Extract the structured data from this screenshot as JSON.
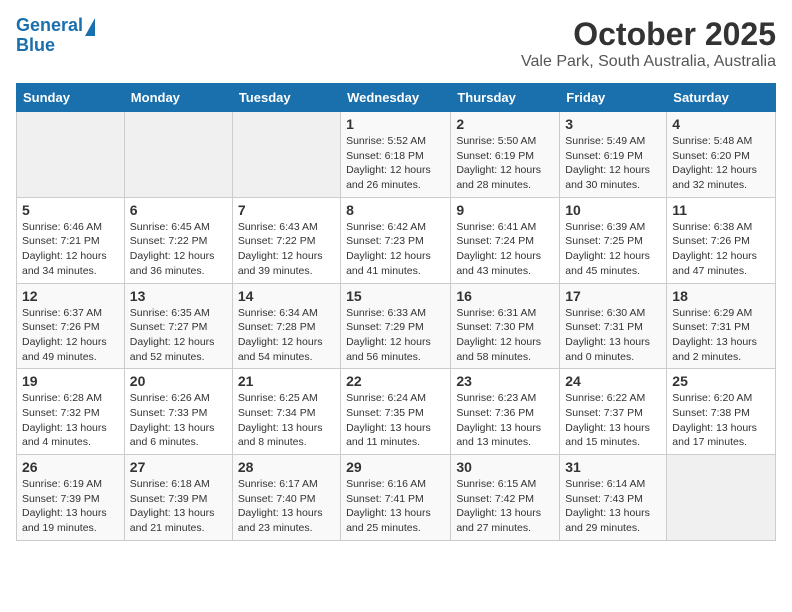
{
  "header": {
    "logo_line1": "General",
    "logo_line2": "Blue",
    "title": "October 2025",
    "subtitle": "Vale Park, South Australia, Australia"
  },
  "days_of_week": [
    "Sunday",
    "Monday",
    "Tuesday",
    "Wednesday",
    "Thursday",
    "Friday",
    "Saturday"
  ],
  "weeks": [
    [
      {
        "day": "",
        "empty": true
      },
      {
        "day": "",
        "empty": true
      },
      {
        "day": "",
        "empty": true
      },
      {
        "day": "1",
        "sunrise": "5:52 AM",
        "sunset": "6:18 PM",
        "daylight": "12 hours and 26 minutes."
      },
      {
        "day": "2",
        "sunrise": "5:50 AM",
        "sunset": "6:19 PM",
        "daylight": "12 hours and 28 minutes."
      },
      {
        "day": "3",
        "sunrise": "5:49 AM",
        "sunset": "6:19 PM",
        "daylight": "12 hours and 30 minutes."
      },
      {
        "day": "4",
        "sunrise": "5:48 AM",
        "sunset": "6:20 PM",
        "daylight": "12 hours and 32 minutes."
      }
    ],
    [
      {
        "day": "5",
        "sunrise": "6:46 AM",
        "sunset": "7:21 PM",
        "daylight": "12 hours and 34 minutes."
      },
      {
        "day": "6",
        "sunrise": "6:45 AM",
        "sunset": "7:22 PM",
        "daylight": "12 hours and 36 minutes."
      },
      {
        "day": "7",
        "sunrise": "6:43 AM",
        "sunset": "7:22 PM",
        "daylight": "12 hours and 39 minutes."
      },
      {
        "day": "8",
        "sunrise": "6:42 AM",
        "sunset": "7:23 PM",
        "daylight": "12 hours and 41 minutes."
      },
      {
        "day": "9",
        "sunrise": "6:41 AM",
        "sunset": "7:24 PM",
        "daylight": "12 hours and 43 minutes."
      },
      {
        "day": "10",
        "sunrise": "6:39 AM",
        "sunset": "7:25 PM",
        "daylight": "12 hours and 45 minutes."
      },
      {
        "day": "11",
        "sunrise": "6:38 AM",
        "sunset": "7:26 PM",
        "daylight": "12 hours and 47 minutes."
      }
    ],
    [
      {
        "day": "12",
        "sunrise": "6:37 AM",
        "sunset": "7:26 PM",
        "daylight": "12 hours and 49 minutes."
      },
      {
        "day": "13",
        "sunrise": "6:35 AM",
        "sunset": "7:27 PM",
        "daylight": "12 hours and 52 minutes."
      },
      {
        "day": "14",
        "sunrise": "6:34 AM",
        "sunset": "7:28 PM",
        "daylight": "12 hours and 54 minutes."
      },
      {
        "day": "15",
        "sunrise": "6:33 AM",
        "sunset": "7:29 PM",
        "daylight": "12 hours and 56 minutes."
      },
      {
        "day": "16",
        "sunrise": "6:31 AM",
        "sunset": "7:30 PM",
        "daylight": "12 hours and 58 minutes."
      },
      {
        "day": "17",
        "sunrise": "6:30 AM",
        "sunset": "7:31 PM",
        "daylight": "13 hours and 0 minutes."
      },
      {
        "day": "18",
        "sunrise": "6:29 AM",
        "sunset": "7:31 PM",
        "daylight": "13 hours and 2 minutes."
      }
    ],
    [
      {
        "day": "19",
        "sunrise": "6:28 AM",
        "sunset": "7:32 PM",
        "daylight": "13 hours and 4 minutes."
      },
      {
        "day": "20",
        "sunrise": "6:26 AM",
        "sunset": "7:33 PM",
        "daylight": "13 hours and 6 minutes."
      },
      {
        "day": "21",
        "sunrise": "6:25 AM",
        "sunset": "7:34 PM",
        "daylight": "13 hours and 8 minutes."
      },
      {
        "day": "22",
        "sunrise": "6:24 AM",
        "sunset": "7:35 PM",
        "daylight": "13 hours and 11 minutes."
      },
      {
        "day": "23",
        "sunrise": "6:23 AM",
        "sunset": "7:36 PM",
        "daylight": "13 hours and 13 minutes."
      },
      {
        "day": "24",
        "sunrise": "6:22 AM",
        "sunset": "7:37 PM",
        "daylight": "13 hours and 15 minutes."
      },
      {
        "day": "25",
        "sunrise": "6:20 AM",
        "sunset": "7:38 PM",
        "daylight": "13 hours and 17 minutes."
      }
    ],
    [
      {
        "day": "26",
        "sunrise": "6:19 AM",
        "sunset": "7:39 PM",
        "daylight": "13 hours and 19 minutes."
      },
      {
        "day": "27",
        "sunrise": "6:18 AM",
        "sunset": "7:39 PM",
        "daylight": "13 hours and 21 minutes."
      },
      {
        "day": "28",
        "sunrise": "6:17 AM",
        "sunset": "7:40 PM",
        "daylight": "13 hours and 23 minutes."
      },
      {
        "day": "29",
        "sunrise": "6:16 AM",
        "sunset": "7:41 PM",
        "daylight": "13 hours and 25 minutes."
      },
      {
        "day": "30",
        "sunrise": "6:15 AM",
        "sunset": "7:42 PM",
        "daylight": "13 hours and 27 minutes."
      },
      {
        "day": "31",
        "sunrise": "6:14 AM",
        "sunset": "7:43 PM",
        "daylight": "13 hours and 29 minutes."
      },
      {
        "day": "",
        "empty": true
      }
    ]
  ]
}
